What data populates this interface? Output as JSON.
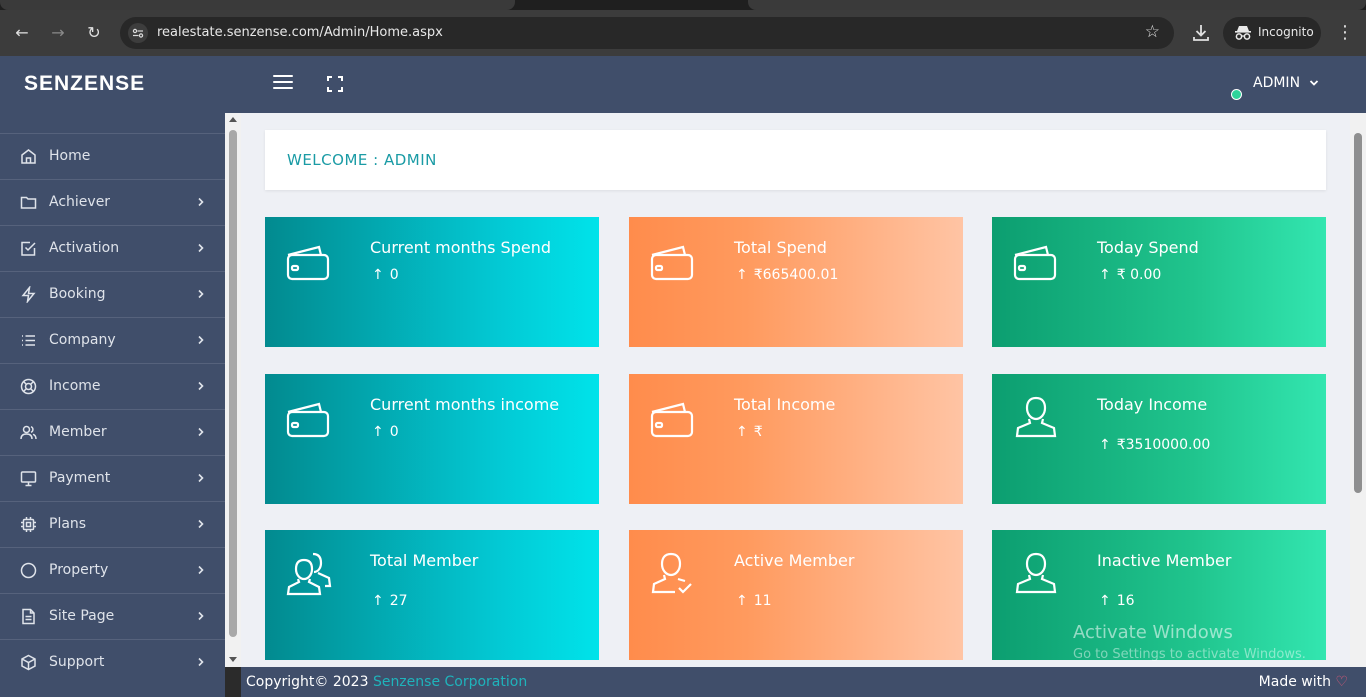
{
  "browser": {
    "url": "realestate.senzense.com/Admin/Home.aspx",
    "mode_label": "Incognito",
    "icons": [
      "back-icon",
      "forward-icon",
      "reload-icon",
      "site-info-icon",
      "bookmark-star-icon",
      "download-icon",
      "incognito-icon",
      "menu-dots-icon"
    ]
  },
  "header": {
    "brand": "SENZENSE",
    "user_menu": "ADMIN",
    "status_color": "#2ed39a"
  },
  "sidebar": {
    "items": [
      {
        "label": "Home",
        "icon": "home-icon"
      },
      {
        "label": "Achiever",
        "icon": "folder-icon"
      },
      {
        "label": "Activation",
        "icon": "checkbox-icon"
      },
      {
        "label": "Booking",
        "icon": "bolt-icon"
      },
      {
        "label": "Company",
        "icon": "list-icon"
      },
      {
        "label": "Income",
        "icon": "lifebuoy-icon"
      },
      {
        "label": "Member",
        "icon": "users-icon"
      },
      {
        "label": "Payment",
        "icon": "monitor-icon"
      },
      {
        "label": "Plans",
        "icon": "cpu-icon"
      },
      {
        "label": "Property",
        "icon": "circle-icon"
      },
      {
        "label": "Site Page",
        "icon": "document-icon"
      },
      {
        "label": "Support",
        "icon": "box-icon"
      }
    ]
  },
  "main": {
    "welcome": "WELCOME : ADMIN",
    "cards": [
      {
        "title": "Current months Spend",
        "value": "0",
        "icon": "wallet-icon",
        "color": "teal"
      },
      {
        "title": "Total Spend",
        "value": "₹665400.01",
        "icon": "wallet-icon",
        "color": "orange"
      },
      {
        "title": "Today Spend",
        "value": "₹ 0.00",
        "icon": "wallet-icon",
        "color": "green"
      },
      {
        "title": "Current months income",
        "value": "0",
        "icon": "wallet-icon",
        "color": "teal"
      },
      {
        "title": "Total Income",
        "value": "₹",
        "icon": "wallet-icon",
        "color": "orange"
      },
      {
        "title": "Today Income",
        "value": "₹3510000.00",
        "icon": "user-icon",
        "color": "green"
      },
      {
        "title": "Total Member",
        "value": "27",
        "icon": "users-icon",
        "color": "teal"
      },
      {
        "title": "Active Member",
        "value": "11",
        "icon": "user-check-icon",
        "color": "orange"
      },
      {
        "title": "Inactive Member",
        "value": "16",
        "icon": "user-icon",
        "color": "green"
      }
    ],
    "arrow": "↑"
  },
  "footer": {
    "copyright": "Copyright© 2023 ",
    "company": "Senzense Corporation",
    "made_with": "Made with ",
    "heart": "♡"
  },
  "overlay": {
    "activate_title": "Activate Windows",
    "activate_sub": "Go to Settings to activate Windows."
  }
}
